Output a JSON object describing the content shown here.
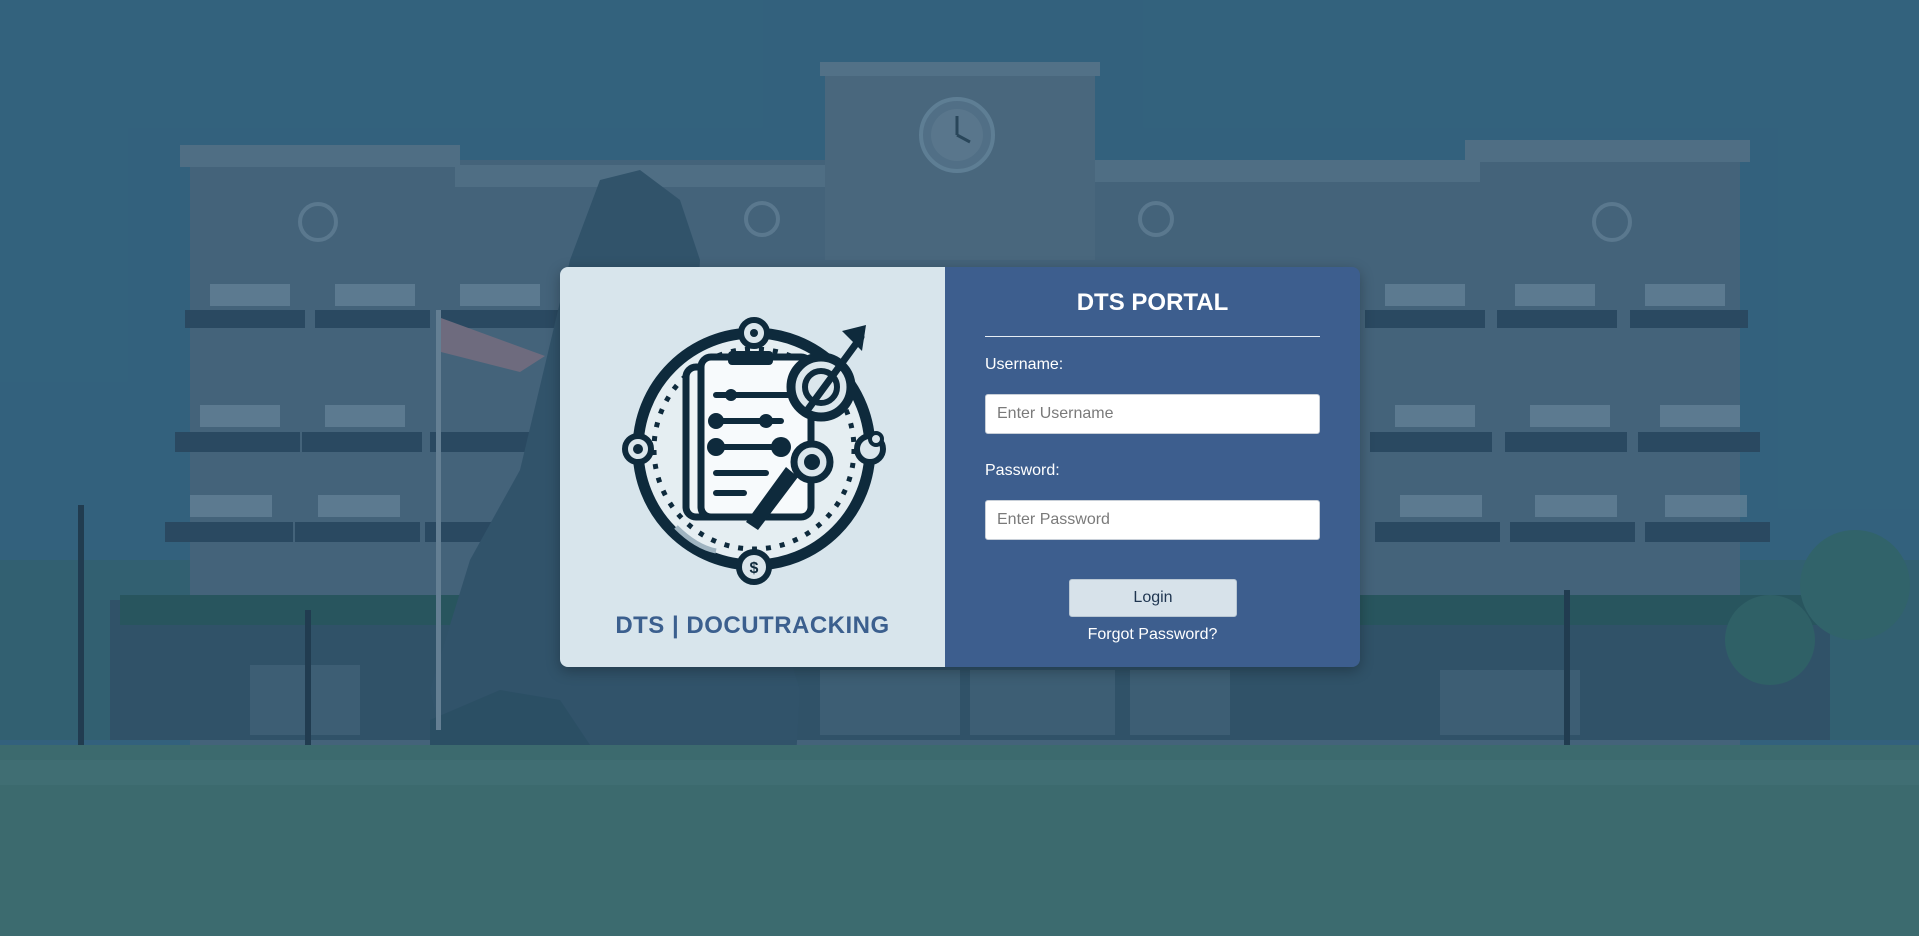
{
  "brand": {
    "title": "DTS | DOCUTRACKING",
    "logo_icon": "document-tracking-logo"
  },
  "login": {
    "portal_title": "DTS PORTAL",
    "username_label": "Username:",
    "username_placeholder": "Enter Username",
    "username_value": "",
    "password_label": "Password:",
    "password_placeholder": "Enter Password",
    "password_value": "",
    "login_button": "Login",
    "forgot_link": "Forgot Password?"
  },
  "colors": {
    "panel_blue": "#3d5e8e",
    "panel_light": "#d8e5ec",
    "brand_text": "#3b5f8e",
    "logo_dark": "#0e2a3c",
    "background_tint": "#3f6c84"
  }
}
